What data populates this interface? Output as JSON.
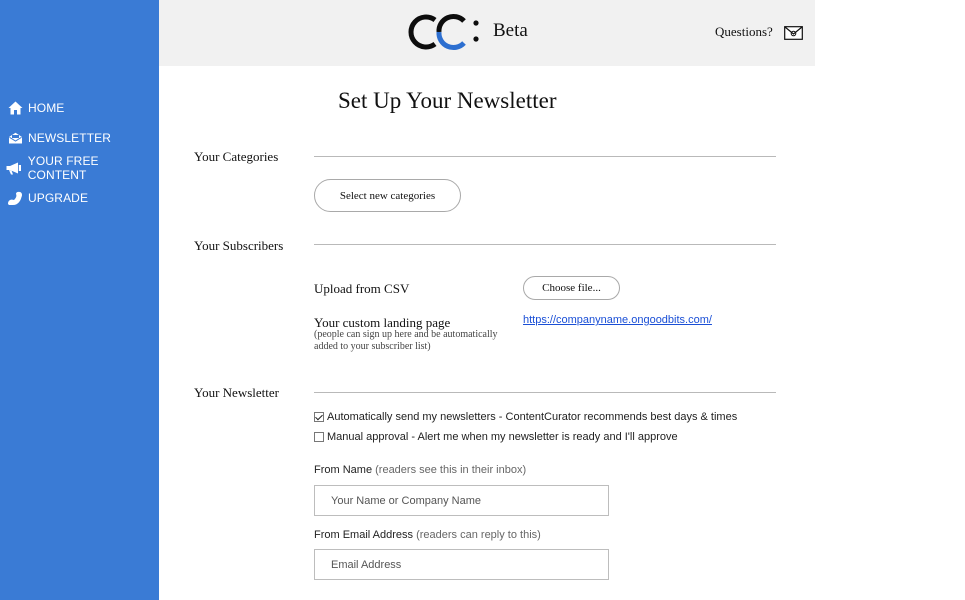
{
  "sidebar": {
    "bg_color": "#3a7bd5",
    "items": [
      {
        "label": "HOME",
        "icon": "home-icon"
      },
      {
        "label": "NEWSLETTER",
        "icon": "open-envelope-icon"
      },
      {
        "label": "YOUR FREE CONTENT",
        "icon": "megaphone-icon"
      },
      {
        "label": "UPGRADE",
        "icon": "flexed-arm-icon"
      }
    ]
  },
  "header": {
    "logo_text": "CC:",
    "beta_label": "Beta",
    "questions_label": "Questions?",
    "mail_icon": "mail-icon"
  },
  "main": {
    "title": "Set Up Your Newsletter",
    "categories": {
      "label": "Your Categories",
      "button_label": "Select new categories"
    },
    "subscribers": {
      "label": "Your Subscribers",
      "upload_label": "Upload from CSV",
      "choose_file_label": "Choose file...",
      "landing_label": "Your custom landing page",
      "landing_note": "(people can sign up here and be automatically added to your subscriber list)",
      "landing_url": "https://companyname.ongoodbits.com/"
    },
    "newsletter": {
      "label": "Your Newsletter",
      "auto_send": {
        "label": "Automatically send my newsletters - ContentCurator recommends best days & times",
        "checked": true
      },
      "manual_approval": {
        "label": "Manual approval - Alert me when my newsletter is ready and I'll approve",
        "checked": false
      },
      "from_name": {
        "label": "From Name",
        "hint": "(readers see this in their inbox)",
        "placeholder": "Your Name or Company Name",
        "value": ""
      },
      "from_email": {
        "label": "From Email Address",
        "hint": "(readers can reply to this)",
        "placeholder": "Email Address",
        "value": ""
      }
    }
  }
}
